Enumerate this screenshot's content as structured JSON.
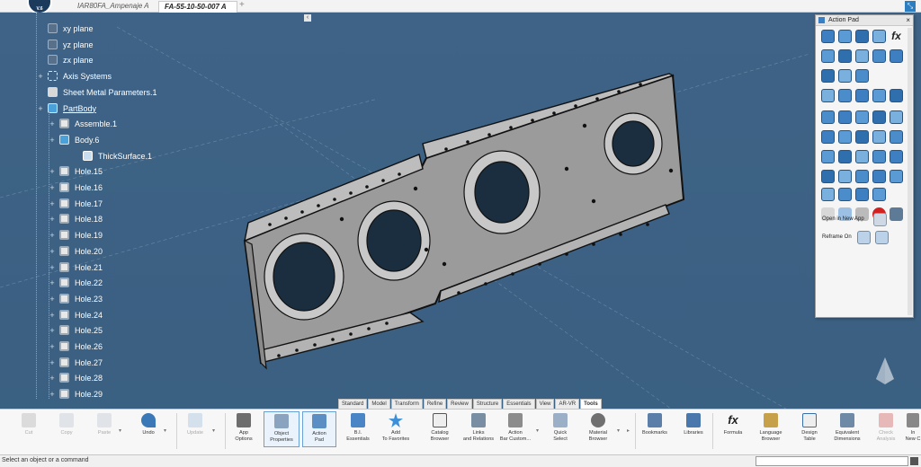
{
  "app": {
    "logo_text": "V.6",
    "tabs": [
      {
        "label": "IAR80FA_Ampenaje A"
      },
      {
        "label": "FA-55-10-50-007 A"
      }
    ],
    "new_tab": "+"
  },
  "tree": {
    "collapse_glyph": "‹",
    "items": [
      {
        "label": "xy plane",
        "icon": "plane-icon"
      },
      {
        "label": "yz plane",
        "icon": "plane-icon"
      },
      {
        "label": "zx plane",
        "icon": "plane-icon"
      },
      {
        "label": "Axis Systems",
        "icon": "axis-system-icon"
      },
      {
        "label": "Sheet Metal Parameters.1",
        "icon": "sheet-metal-icon"
      },
      {
        "label": "PartBody",
        "icon": "part-body-icon"
      },
      {
        "label": "Assemble.1",
        "icon": "hole-icon"
      },
      {
        "label": "Body.6",
        "icon": "body-icon"
      },
      {
        "label": "ThickSurface.1",
        "icon": "thick-surface-icon"
      },
      {
        "label": "Hole.15",
        "icon": "hole-icon"
      },
      {
        "label": "Hole.16",
        "icon": "hole-icon"
      },
      {
        "label": "Hole.17",
        "icon": "hole-icon"
      },
      {
        "label": "Hole.18",
        "icon": "hole-icon"
      },
      {
        "label": "Hole.19",
        "icon": "hole-icon"
      },
      {
        "label": "Hole.20",
        "icon": "hole-icon"
      },
      {
        "label": "Hole.21",
        "icon": "hole-icon"
      },
      {
        "label": "Hole.22",
        "icon": "hole-icon"
      },
      {
        "label": "Hole.23",
        "icon": "hole-icon"
      },
      {
        "label": "Hole.24",
        "icon": "hole-icon"
      },
      {
        "label": "Hole.25",
        "icon": "hole-icon"
      },
      {
        "label": "Hole.26",
        "icon": "hole-icon"
      },
      {
        "label": "Hole.27",
        "icon": "hole-icon"
      },
      {
        "label": "Hole.28",
        "icon": "hole-icon"
      },
      {
        "label": "Hole.29",
        "icon": "hole-icon"
      }
    ]
  },
  "action_pad": {
    "title": "Action Pad",
    "close": "×",
    "open_in_new_app": "Open in New App",
    "reframe_on": "Reframe On",
    "formula_glyph": "fx"
  },
  "ribbon": {
    "tabs": [
      "Standard",
      "Model",
      "Transform",
      "Refine",
      "Review",
      "Structure",
      "Essentials",
      "View",
      "AR-VR",
      "Tools"
    ],
    "active_tab": "Tools",
    "formula_glyph": "fx",
    "buttons": {
      "cut": "Cut",
      "copy": "Copy",
      "paste": "Paste",
      "undo": "Undo",
      "update": "Update",
      "app_options_1": "App",
      "app_options_2": "Options",
      "object_properties_1": "Object",
      "object_properties_2": "Properties",
      "action_pad_1": "Action",
      "action_pad_2": "Pad",
      "bi_essentials_1": "B.I.",
      "bi_essentials_2": "Essentials",
      "add_favorites_1": "Add",
      "add_favorites_2": "To Favorites",
      "catalog_browser_1": "Catalog",
      "catalog_browser_2": "Browser",
      "links_relations_1": "Links",
      "links_relations_2": "and Relations",
      "action_bar_1": "Action",
      "action_bar_2": "Bar Custom...",
      "quick_select_1": "Quick",
      "quick_select_2": "Select",
      "material_browser_1": "Material",
      "material_browser_2": "Browser",
      "bookmarks": "Bookmarks",
      "libraries": "Libraries",
      "formula": "Formula",
      "language_browser_1": "Language",
      "language_browser_2": "Browser",
      "design_table_1": "Design",
      "design_table_2": "Table",
      "equivalent_dimensions_1": "Equivalent",
      "equivalent_dimensions_2": "Dimensions",
      "check_analysis_1": "Check",
      "check_analysis_2": "Analysis",
      "more_1": "In",
      "more_2": "New C"
    }
  },
  "status": {
    "message": "Select an object or a command"
  },
  "colors": {
    "background": "#3d6183",
    "part": "#9a9a9a",
    "accent": "#2d7ec1"
  }
}
